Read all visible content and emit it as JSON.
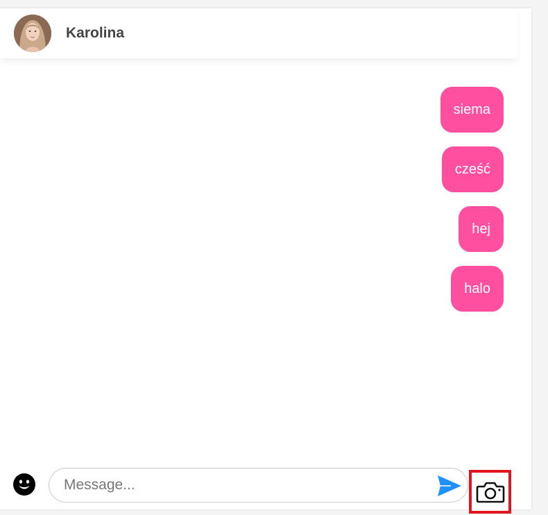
{
  "header": {
    "contact_name": "Karolina",
    "avatar_icon": "avatar-photo"
  },
  "messages": [
    {
      "text": "siema",
      "direction": "outgoing"
    },
    {
      "text": "cześć",
      "direction": "outgoing"
    },
    {
      "text": "hej",
      "direction": "outgoing"
    },
    {
      "text": "halo",
      "direction": "outgoing"
    }
  ],
  "composer": {
    "placeholder": "Message...",
    "value": "",
    "emoji_icon": "smiley-icon",
    "send_icon": "send-icon",
    "camera_icon": "camera-icon"
  },
  "colors": {
    "bubble": "#ff4fa1",
    "bubble_text": "#ffffff",
    "send": "#1e90ff",
    "highlight": "#e0151f"
  }
}
